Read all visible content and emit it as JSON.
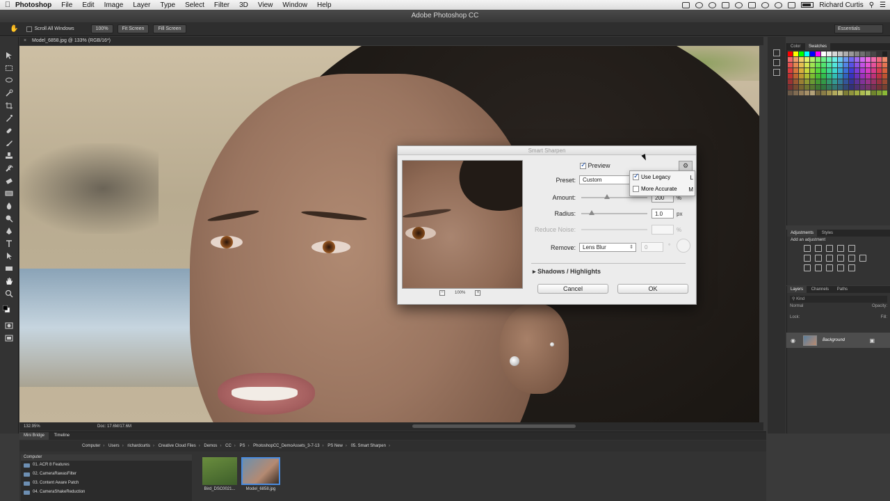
{
  "menubar": {
    "app_name": "Photoshop",
    "items": [
      "File",
      "Edit",
      "Image",
      "Layer",
      "Type",
      "Select",
      "Filter",
      "3D",
      "View",
      "Window",
      "Help"
    ],
    "user": "Richard Curtis"
  },
  "titlebar": {
    "title": "Adobe Photoshop CC"
  },
  "options": {
    "scroll_all": "Scroll All Windows",
    "zoom_100": "100%",
    "fit_screen": "Fit Screen",
    "fill_screen": "Fill Screen",
    "workspace": "Essentials"
  },
  "document": {
    "tab_title": "Model_6858.jpg @ 133% (RGB/16*)"
  },
  "status": {
    "zoom": "132.95%",
    "doc": "Doc: 17.6M/17.6M"
  },
  "minibridge": {
    "tabs": [
      "Mini Bridge",
      "Timeline"
    ],
    "path": [
      "Computer",
      "Users",
      "richardcurtis",
      "Creative Cloud Files",
      "Demos",
      "CC",
      "PS",
      "PhotoshopCC_DemoAssets_3-7-13",
      "PS New",
      "05. Smart Sharpen"
    ],
    "sidebar_header": "Computer",
    "folders": [
      "01. ACR 8 Features",
      "02. CameraRawasFilter",
      "03. Content Aware Patch",
      "04. CameraShakeReduction"
    ],
    "thumbs": [
      {
        "name": "Bird_DSC0021..."
      },
      {
        "name": "Model_6858.jpg"
      }
    ]
  },
  "panels": {
    "color_tabs": [
      "Color",
      "Swatches"
    ],
    "adjustments_tabs": [
      "Adjustments",
      "Styles"
    ],
    "add_adjustment": "Add an adjustment",
    "layers_tabs": [
      "Layers",
      "Channels",
      "Paths"
    ],
    "kind": "Kind",
    "blend_mode": "Normal",
    "opacity_label": "Opacity:",
    "lock_label": "Lock:",
    "fill_label": "Fill:",
    "layer_name": "Background"
  },
  "dialog": {
    "title": "Smart Sharpen",
    "preview_label": "Preview",
    "preview_checked": true,
    "zoom": "100%",
    "preset_label": "Preset:",
    "preset_value": "Custom",
    "amount_label": "Amount:",
    "amount_value": "200",
    "amount_unit": "%",
    "radius_label": "Radius:",
    "radius_value": "1.0",
    "radius_unit": "px",
    "noise_label": "Reduce Noise:",
    "noise_unit": "%",
    "remove_label": "Remove:",
    "remove_value": "Lens Blur",
    "angle_value": "0",
    "angle_unit": "°",
    "shadows_label": "Shadows / Highlights",
    "cancel": "Cancel",
    "ok": "OK"
  },
  "gear_menu": {
    "use_legacy": "Use Legacy",
    "use_legacy_key": "L",
    "more_accurate": "More Accurate",
    "more_accurate_key": "M"
  },
  "colors": {
    "dialog_bg": "#ececec",
    "panel_bg": "#333333",
    "accent": "#1a4ea8"
  }
}
